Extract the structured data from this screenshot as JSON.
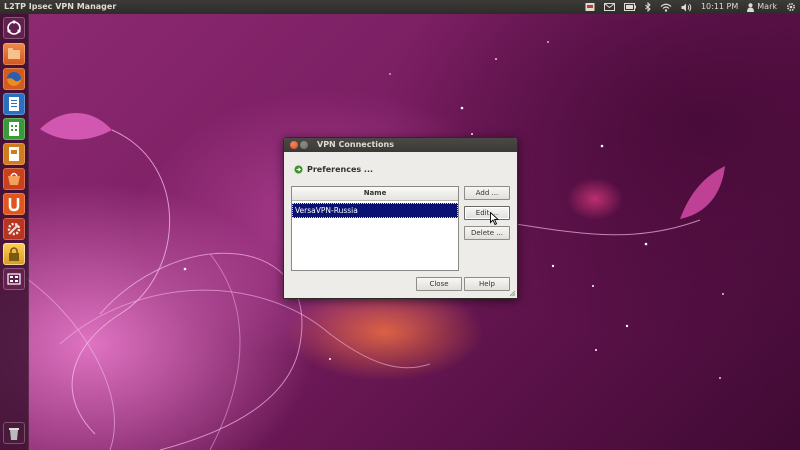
{
  "top_panel": {
    "app_title": "L2TP Ipsec VPN Manager",
    "clock": "10:11 PM",
    "user": "Mark",
    "indicators": [
      "vpn-indicator-icon",
      "mail-icon",
      "battery-icon",
      "bluetooth-icon",
      "wifi-icon",
      "volume-icon",
      "user-icon",
      "gear-icon"
    ]
  },
  "launcher": {
    "items": [
      "ubuntu-dash-icon",
      "home-folder-icon",
      "firefox-icon",
      "writer-icon",
      "calc-icon",
      "impress-icon",
      "software-center-icon",
      "ubuntu-one-icon",
      "system-settings-icon",
      "vpn-manager-icon",
      "workspace-switcher-icon",
      "trash-icon"
    ]
  },
  "dialog": {
    "title": "VPN Connections",
    "preferences_label": "Preferences ...",
    "column_header": "Name",
    "connections": [
      "VersaVPN-Russia"
    ],
    "buttons": {
      "add": "Add ...",
      "edit": "Edit ...",
      "delete": "Delete ...",
      "close": "Close",
      "help": "Help"
    }
  },
  "colors": {
    "selection": "#0a1273",
    "panel": "#3c3b37",
    "wallpaper": "#7a1e62"
  }
}
